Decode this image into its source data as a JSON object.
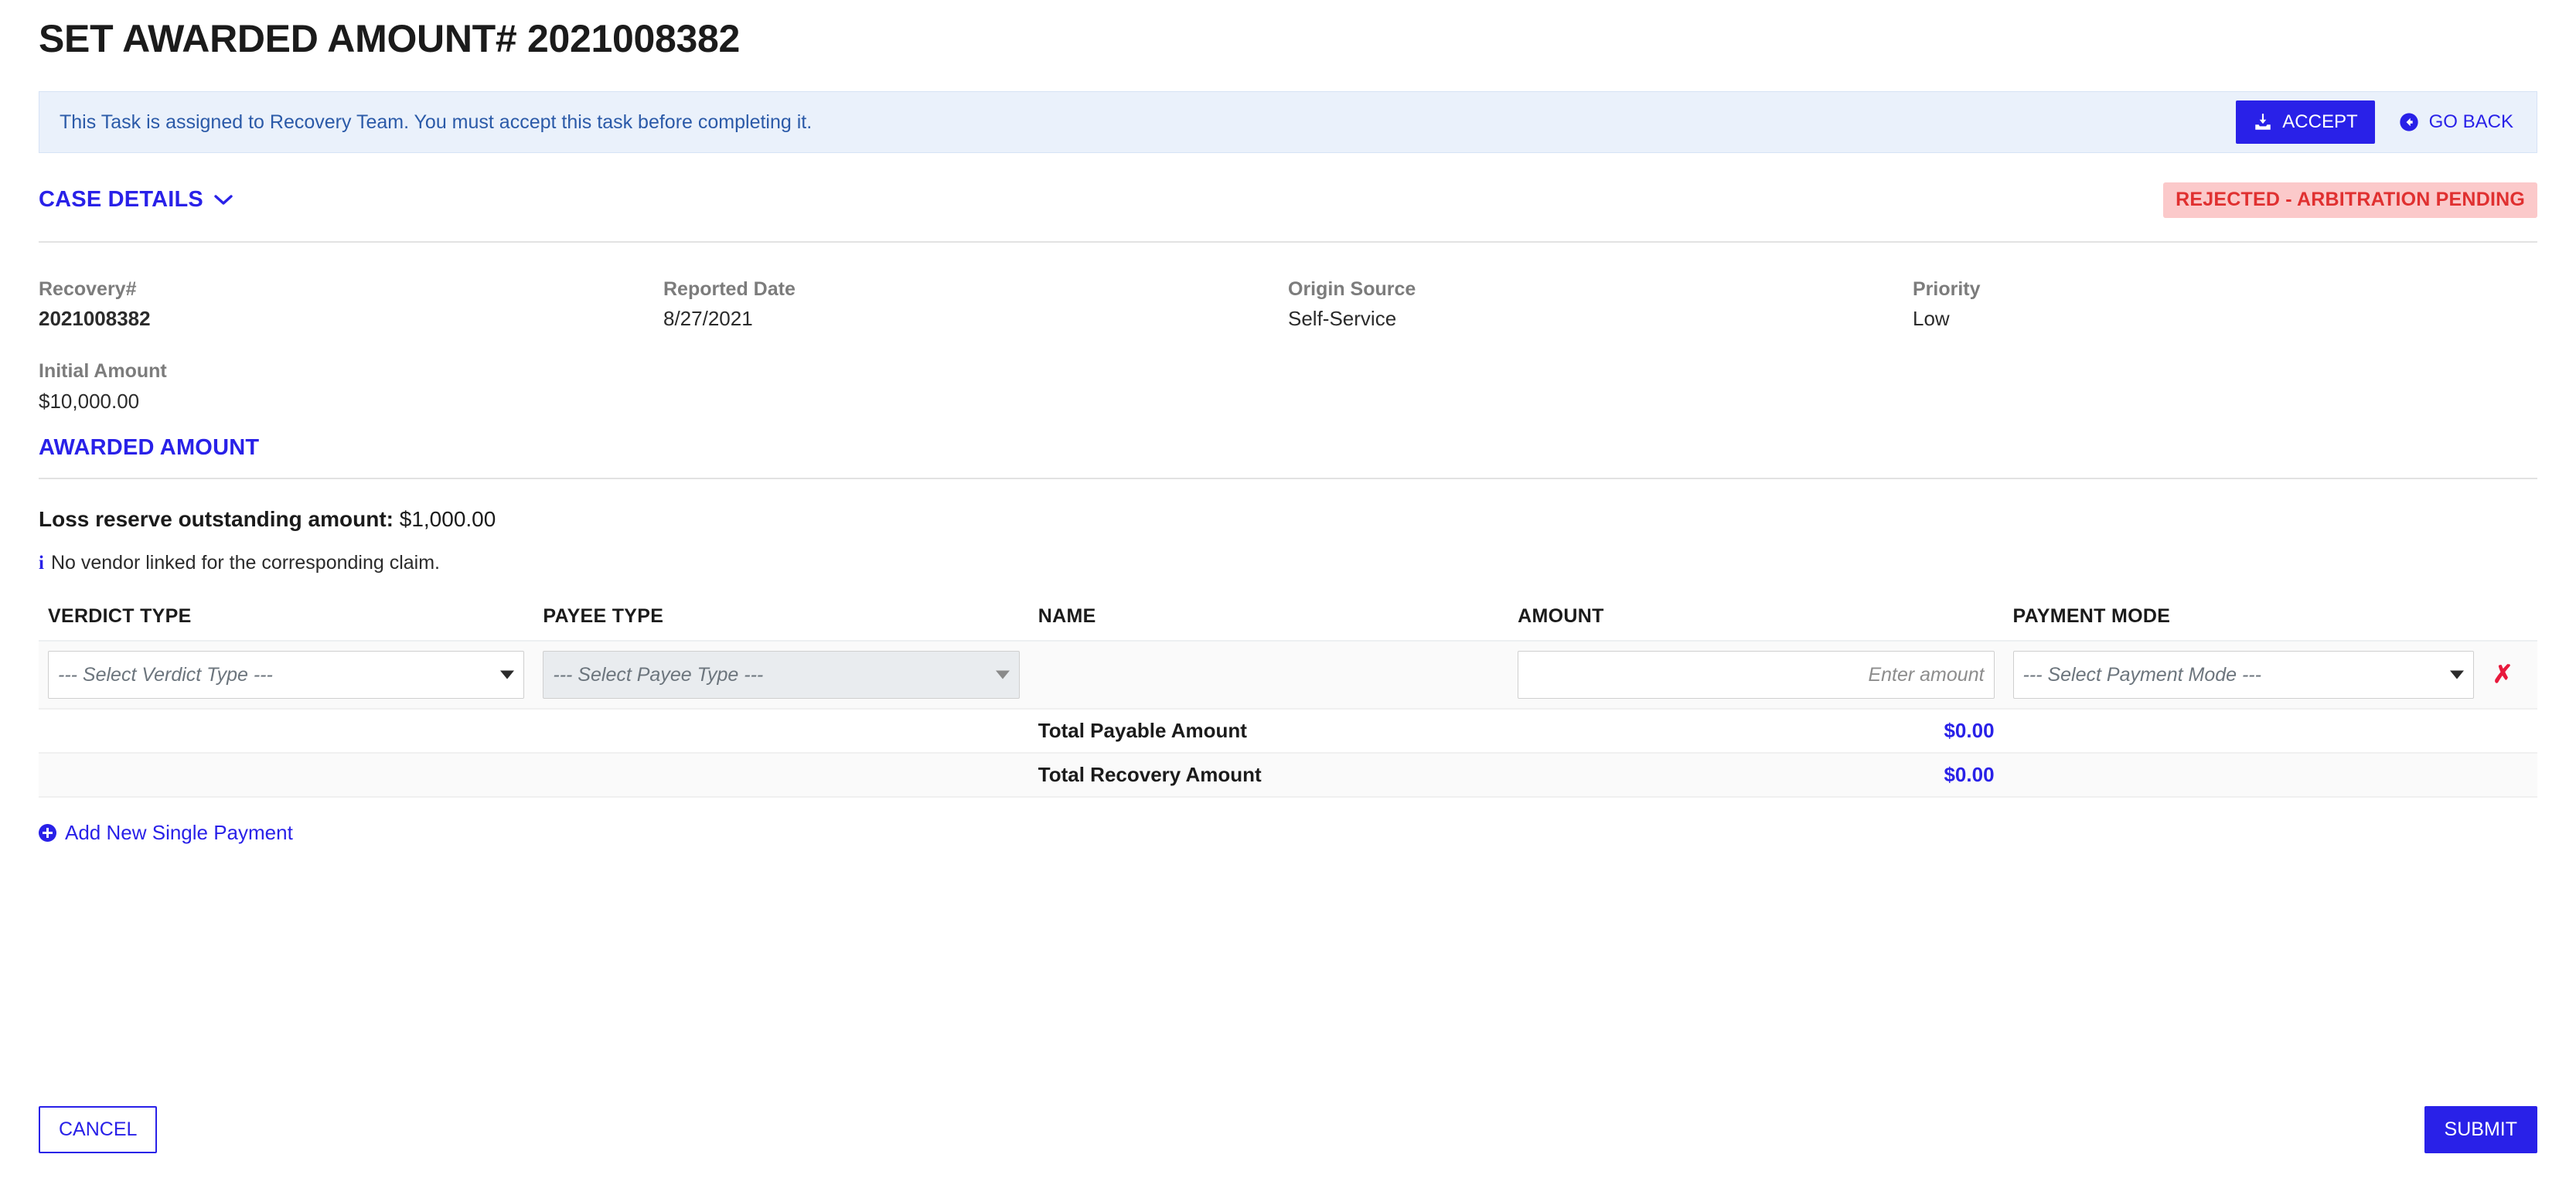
{
  "page": {
    "title": "SET AWARDED AMOUNT# 2021008382"
  },
  "alert": {
    "message": "This Task is assigned to Recovery Team. You must accept this task before completing it.",
    "accept_label": "ACCEPT",
    "accept_icon": "download-inbox-icon",
    "goback_label": "GO BACK",
    "goback_icon": "arrow-circle-left-icon",
    "accent_color": "#2921e8",
    "background": "#eaf1fb",
    "text_color": "#2b5aa8"
  },
  "case_details": {
    "section_label": "CASE DETAILS",
    "chevron_icon": "chevron-down-icon",
    "status_badge": "REJECTED - ARBITRATION PENDING",
    "status_badge_color": "#e03030",
    "status_badge_background": "#fbc9ca",
    "fields": [
      {
        "label": "Recovery#",
        "value": "2021008382",
        "bold": true
      },
      {
        "label": "Reported Date",
        "value": "8/27/2021",
        "bold": false
      },
      {
        "label": "Origin Source",
        "value": "Self-Service",
        "bold": false
      },
      {
        "label": "Priority",
        "value": "Low",
        "bold": false
      },
      {
        "label": "Initial Amount",
        "value": "$10,000.00",
        "bold": false
      }
    ]
  },
  "awarded_amount": {
    "section_title": "AWARDED AMOUNT",
    "loss_reserve_label": "Loss reserve outstanding amount:",
    "loss_reserve_value": "$1,000.00",
    "note_icon": "info-icon",
    "note_text": "No vendor linked for the corresponding claim.",
    "table": {
      "headers": [
        "VERDICT TYPE",
        "PAYEE TYPE",
        "NAME",
        "AMOUNT",
        "PAYMENT MODE"
      ],
      "row": {
        "verdict_type_placeholder": "--- Select Verdict Type ---",
        "verdict_type_value": "",
        "verdict_type_disabled": false,
        "payee_type_placeholder": "--- Select Payee Type ---",
        "payee_type_value": "",
        "payee_type_disabled": true,
        "name_value": "",
        "amount_placeholder": "Enter amount",
        "amount_value": "",
        "payment_mode_placeholder": "--- Select Payment Mode ---",
        "payment_mode_value": "",
        "payment_mode_disabled": false,
        "delete_label": "✗",
        "delete_icon": "remove-row-icon"
      },
      "totals": [
        {
          "label": "Total Payable Amount",
          "value": "$0.00"
        },
        {
          "label": "Total Recovery Amount",
          "value": "$0.00"
        }
      ]
    },
    "add_payment_label": "Add New Single Payment",
    "add_payment_icon": "plus-circle-icon"
  },
  "footer": {
    "cancel_label": "CANCEL",
    "submit_label": "SUBMIT"
  }
}
